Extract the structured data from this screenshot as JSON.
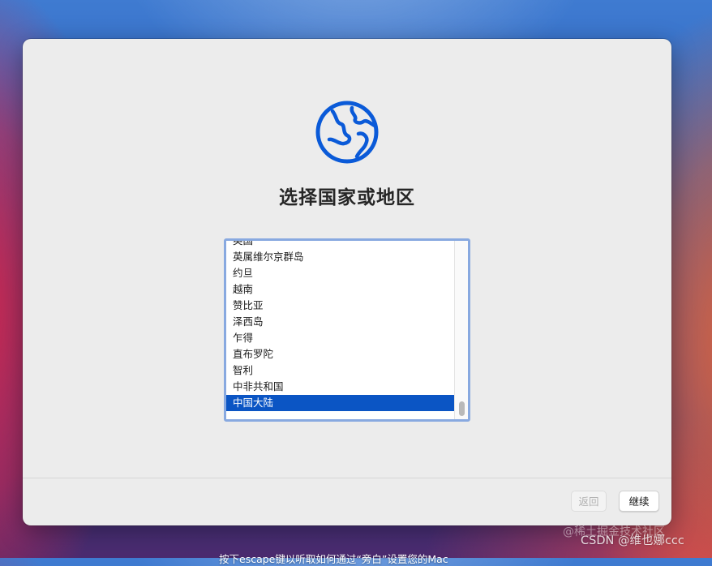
{
  "setup": {
    "globe_icon": "globe-icon",
    "title": "选择国家或地区",
    "countries": [
      "英国",
      "英属维尔京群岛",
      "约旦",
      "越南",
      "赞比亚",
      "泽西岛",
      "乍得",
      "直布罗陀",
      "智利",
      "中非共和国",
      "中国大陆"
    ],
    "selected_country": "中国大陆",
    "buttons": {
      "back_label": "返回",
      "continue_label": "继续"
    },
    "accent_color": "#0b55c4",
    "focus_ring_color": "#88a9e0"
  },
  "footer": {
    "hint": "按下escape键以听取如何通过“旁白”设置您的Mac"
  },
  "watermark": {
    "line1": "@稀土掘金技术社区",
    "line2": "CSDN @维也娜ccc"
  }
}
